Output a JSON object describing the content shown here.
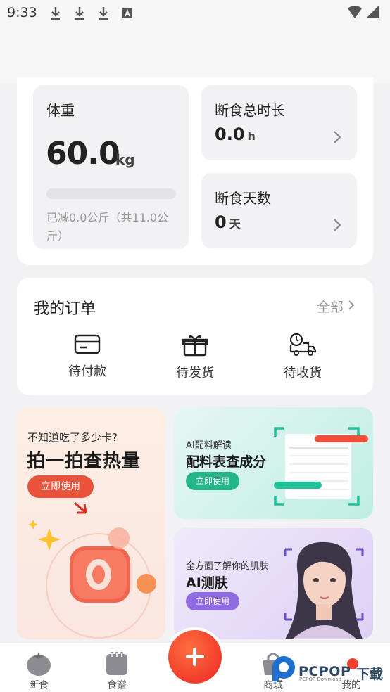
{
  "status_bar": {
    "time": "9:33"
  },
  "stats": {
    "weight_title": "体重",
    "weight_value": "60.0",
    "weight_unit": "kg",
    "weight_progress": 0,
    "weight_note": "已减0.0公斤（共11.0公斤）",
    "fast_total_title": "断食总时长",
    "fast_total_value": "0.0",
    "fast_total_unit": "h",
    "fast_days_title": "断食天数",
    "fast_days_value": "0",
    "fast_days_unit": "天"
  },
  "orders": {
    "title": "我的订单",
    "all_label": "全部",
    "items": [
      {
        "label": "待付款",
        "icon": "card-icon"
      },
      {
        "label": "待发货",
        "icon": "gift-icon"
      },
      {
        "label": "待收货",
        "icon": "delivery-truck-icon"
      }
    ]
  },
  "promos": {
    "calorie": {
      "subtitle": "不知道吃了多少卡?",
      "title": "拍一拍查热量",
      "button": "立即使用"
    },
    "ingredients": {
      "subtitle": "AI配料解读",
      "title": "配料表查成分",
      "button": "立即使用"
    },
    "skin": {
      "subtitle": "全方面了解你的肌肤",
      "title": "AI测肤",
      "button": "立即使用"
    }
  },
  "tabbar": {
    "items": [
      {
        "label": "断食",
        "icon": "tomato-icon"
      },
      {
        "label": "食谱",
        "icon": "notebook-icon"
      },
      {
        "label": "商城",
        "icon": "shopping-bag-icon"
      },
      {
        "label": "我的",
        "icon": "profile-icon"
      }
    ],
    "fab_icon": "plus-icon"
  },
  "watermark": {
    "brand": "PCPOP",
    "suffix": "下载",
    "small": "PCPOP Download"
  },
  "colors": {
    "accent": "#ee3e2c",
    "green": "#24b58a",
    "purple": "#8f6ae0"
  }
}
